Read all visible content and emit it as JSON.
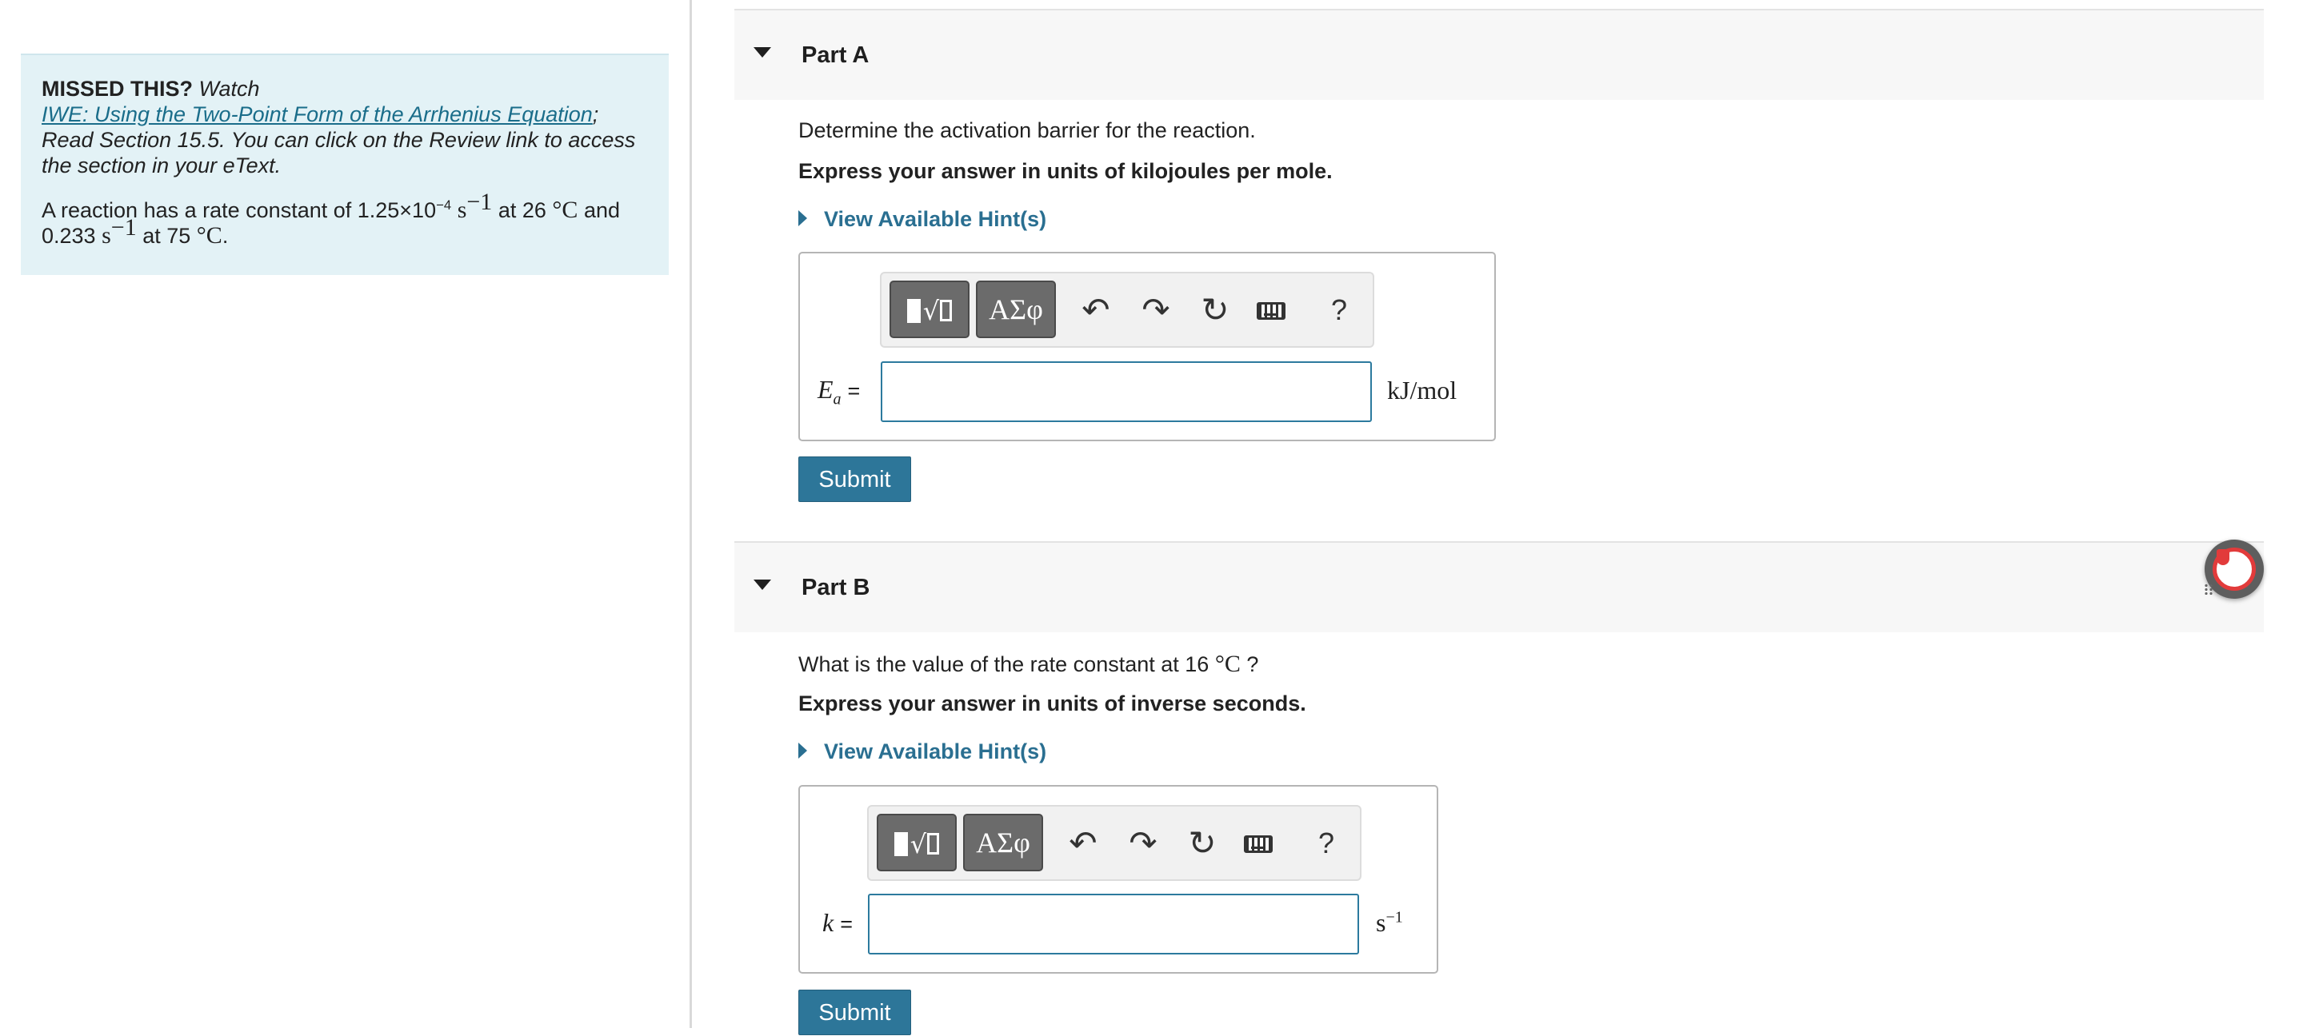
{
  "left_panel": {
    "missed_label": "MISSED THIS?",
    "watch_label": "Watch",
    "video_link": "IWE: Using the Two-Point Form of the Arrhenius Equation",
    "read_text": "; Read Section 15.5. You can click on the Review link to access the section in your eText.",
    "problem": {
      "pre": "A reaction has a rate constant of 1.25×10",
      "exp": "−4",
      "unit1": "s",
      "unit1_exp": "−1",
      "at1": "at 26",
      "temp_unit1": "°C",
      "and": "and",
      "value2": "0.233",
      "unit2": "s",
      "unit2_exp": "−1",
      "at2": "at 75",
      "temp_unit2": "°C",
      "end": "."
    }
  },
  "part_a": {
    "title": "Part A",
    "question": "Determine the activation barrier for the reaction.",
    "instruction": "Express your answer in units of kilojoules per mole.",
    "hint_label": "View Available Hint(s)",
    "toolbar": {
      "templates_label": "√",
      "symbols_label": "ΑΣφ",
      "undo_icon": "↶",
      "redo_icon": "↷",
      "reset_icon": "↻",
      "help_label": "?"
    },
    "var_symbol": "E",
    "var_sub": "a",
    "equals": "=",
    "input_value": "",
    "unit": "kJ/mol",
    "submit_label": "Submit"
  },
  "part_b": {
    "title": "Part B",
    "question_pre": "What is the value of the rate constant at 16",
    "question_unit": "°C",
    "question_end": "?",
    "instruction": "Express your answer in units of inverse seconds.",
    "hint_label": "View Available Hint(s)",
    "toolbar": {
      "templates_label": "√",
      "symbols_label": "ΑΣφ",
      "undo_icon": "↶",
      "redo_icon": "↷",
      "reset_icon": "↻",
      "help_label": "?"
    },
    "var_symbol": "k",
    "equals": "=",
    "input_value": "",
    "unit": "s",
    "unit_exp": "−1",
    "submit_label": "Submit"
  },
  "icons": [
    "collapse-caret-icon",
    "hint-expand-icon",
    "templates-icon",
    "symbols-icon",
    "undo-icon",
    "redo-icon",
    "reset-icon",
    "keyboard-icon",
    "help-icon",
    "feedback-widget-icon"
  ],
  "colors": {
    "accent": "#2d7699",
    "info_bg": "#e3f2f6",
    "link": "#1a6d8a",
    "input_border": "#2c7a9e",
    "widget_red": "#e23b3b"
  }
}
